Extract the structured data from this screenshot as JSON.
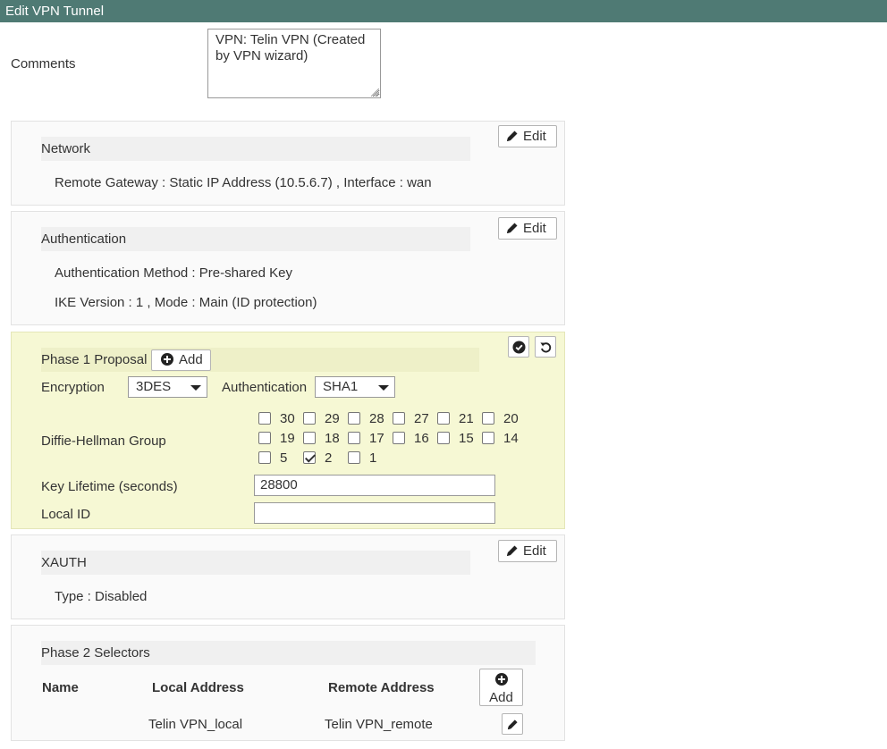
{
  "window": {
    "title": "Edit VPN Tunnel"
  },
  "comments": {
    "label": "Comments",
    "value": "VPN: Telin VPN (Created by VPN wizard)"
  },
  "network": {
    "header": "Network",
    "edit_label": "Edit",
    "remote_gateway": "Remote Gateway : Static IP Address (10.5.6.7) , Interface : wan"
  },
  "authentication": {
    "header": "Authentication",
    "edit_label": "Edit",
    "method": "Authentication Method : Pre-shared Key",
    "ike": "IKE Version : 1 , Mode : Main (ID protection)"
  },
  "phase1": {
    "header": "Phase 1 Proposal",
    "add_label": "Add",
    "encryption_label": "Encryption",
    "encryption_value": "3DES",
    "authentication_label": "Authentication",
    "authentication_value": "SHA1",
    "dh_label": "Diffie-Hellman Group",
    "dh_groups": [
      {
        "label": "30",
        "checked": false
      },
      {
        "label": "29",
        "checked": false
      },
      {
        "label": "28",
        "checked": false
      },
      {
        "label": "27",
        "checked": false
      },
      {
        "label": "21",
        "checked": false
      },
      {
        "label": "20",
        "checked": false
      },
      {
        "label": "19",
        "checked": false
      },
      {
        "label": "18",
        "checked": false
      },
      {
        "label": "17",
        "checked": false
      },
      {
        "label": "16",
        "checked": false
      },
      {
        "label": "15",
        "checked": false
      },
      {
        "label": "14",
        "checked": false
      },
      {
        "label": "5",
        "checked": false
      },
      {
        "label": "2",
        "checked": true
      },
      {
        "label": "1",
        "checked": false
      }
    ],
    "key_lifetime_label": "Key Lifetime (seconds)",
    "key_lifetime_value": "28800",
    "local_id_label": "Local ID",
    "local_id_value": ""
  },
  "xauth": {
    "header": "XAUTH",
    "edit_label": "Edit",
    "type": "Type : Disabled"
  },
  "phase2": {
    "header": "Phase 2 Selectors",
    "columns": {
      "name": "Name",
      "local": "Local Address",
      "remote": "Remote Address"
    },
    "add_label": "Add",
    "rows": [
      {
        "name": "",
        "local": "Telin VPN_local",
        "remote": "Telin VPN_remote"
      }
    ]
  },
  "colors": {
    "titlebar": "#4f7a74",
    "phase1_bg": "#f6f8d4"
  },
  "icons": {
    "edit": "pencil-icon",
    "add": "plus-circle-icon",
    "apply": "check-circle-icon",
    "revert": "undo-icon"
  }
}
